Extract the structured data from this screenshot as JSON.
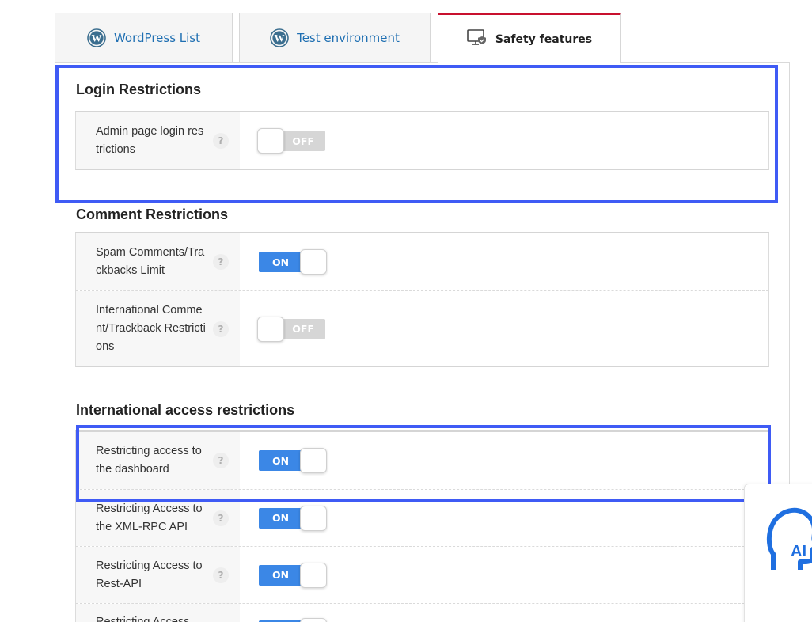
{
  "tabs": [
    {
      "label": "WordPress List",
      "icon": "wordpress-icon",
      "active": false
    },
    {
      "label": "Test environment",
      "icon": "wordpress-icon",
      "active": false
    },
    {
      "label": "Safety features",
      "icon": "monitor-shield-icon",
      "active": true
    }
  ],
  "sections": {
    "login": {
      "title": "Login Restrictions",
      "rows": [
        {
          "label": "Admin page login restrictions",
          "state": "OFF"
        }
      ]
    },
    "comment": {
      "title": "Comment Restrictions",
      "rows": [
        {
          "label": "Spam Comments/Trackbacks Limit",
          "state": "ON"
        },
        {
          "label": "International Comment/Trackback Restrictions",
          "state": "OFF"
        }
      ]
    },
    "international": {
      "title": "International access restrictions",
      "rows": [
        {
          "label": "Restricting access to the dashboard",
          "state": "ON"
        },
        {
          "label": "Restricting Access to the XML-RPC API",
          "state": "ON"
        },
        {
          "label": "Restricting Access to Rest-API",
          "state": "ON"
        },
        {
          "label": "Restricting Access",
          "state": "ON"
        }
      ]
    }
  },
  "help_glyph": "?",
  "ai_widget": {
    "label": "AI",
    "icon": "ai-head-icon"
  },
  "colors": {
    "accent_tab": "#c8102e",
    "toggle_on": "#3b87e6",
    "toggle_off": "#d6d6d6",
    "highlight": "#3f5bf5",
    "link": "#1f6fb2"
  }
}
